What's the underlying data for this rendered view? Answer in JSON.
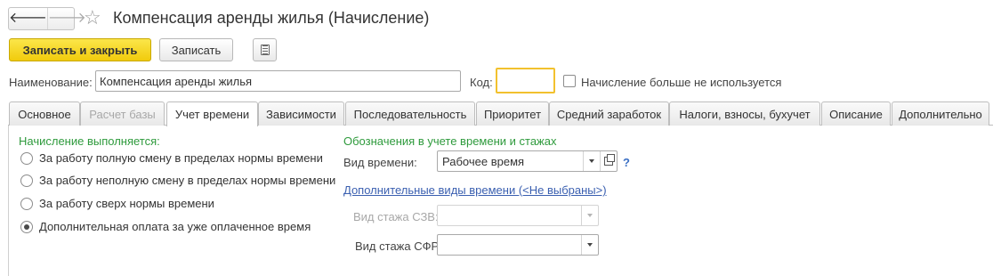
{
  "window": {
    "title": "Компенсация аренды жилья (Начисление)",
    "back_glyph": "🡐",
    "forward_glyph": "🡒",
    "favorite_glyph": "☆"
  },
  "toolbar": {
    "save_close_label": "Записать и закрыть",
    "save_label": "Записать"
  },
  "header_fields": {
    "name_label": "Наименование:",
    "name_value": "Компенсация аренды жилья",
    "code_label": "Код:",
    "code_value": "",
    "unused_label": "Начисление больше не используется",
    "unused_checked": false
  },
  "tabs": [
    {
      "label": "Основное",
      "state": "normal"
    },
    {
      "label": "Расчет базы",
      "state": "disabled"
    },
    {
      "label": "Учет времени",
      "state": "active"
    },
    {
      "label": "Зависимости",
      "state": "normal"
    },
    {
      "label": "Последовательность",
      "state": "normal"
    },
    {
      "label": "Приоритет",
      "state": "normal"
    },
    {
      "label": "Средний заработок",
      "state": "normal"
    },
    {
      "label": "Налоги, взносы, бухучет",
      "state": "normal"
    },
    {
      "label": "Описание",
      "state": "normal"
    },
    {
      "label": "Дополнительно",
      "state": "normal"
    }
  ],
  "time_accounting": {
    "accrual_heading": "Начисление выполняется:",
    "options": [
      {
        "label": "За работу полную смену в пределах нормы времени",
        "selected": false
      },
      {
        "label": "За работу неполную смену в пределах нормы времени",
        "selected": false
      },
      {
        "label": "За работу сверх нормы времени",
        "selected": false
      },
      {
        "label": "Дополнительная оплата за уже оплаченное время",
        "selected": true
      }
    ],
    "designations_heading": "Обозначения в учете времени и стажах",
    "time_type_label": "Вид времени:",
    "time_type_value": "Рабочее время",
    "help_mark": "?",
    "extra_time_types_link": "Дополнительные виды времени (<Не выбраны>)",
    "szv_label": "Вид стажа СЗВ:",
    "szv_value": "",
    "sfr_label": "Вид стажа СФР:",
    "sfr_value": ""
  },
  "colors": {
    "primary_button": "#f1cb0c",
    "section_heading": "#2e9a3c",
    "link": "#3a5fb0",
    "focus_border": "#f2c12e"
  }
}
